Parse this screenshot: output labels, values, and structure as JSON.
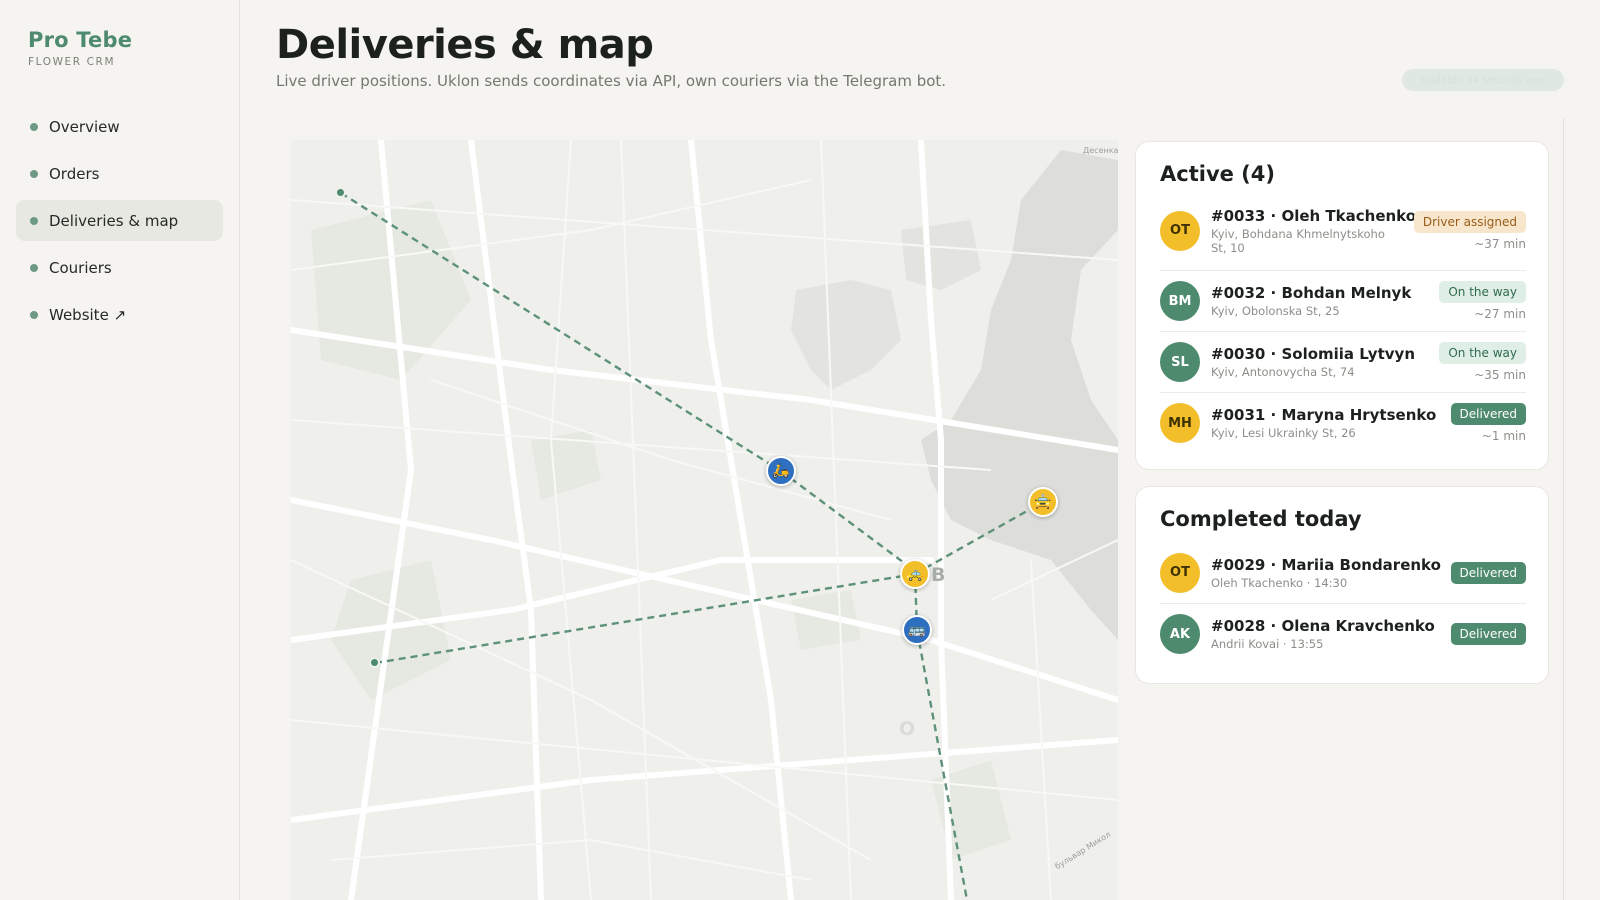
{
  "brand": {
    "name": "Pro Tebe",
    "subtitle": "FLOWER CRM"
  },
  "nav": [
    {
      "label": "Overview",
      "active": false
    },
    {
      "label": "Orders",
      "active": false
    },
    {
      "label": "Deliveries & map",
      "active": true
    },
    {
      "label": "Couriers",
      "active": false
    },
    {
      "label": "Website ↗",
      "active": false
    }
  ],
  "header": {
    "title": "Deliveries & map",
    "subtitle": "Live driver positions. Uklon sends coordinates via API, own couriers via the Telegram bot.",
    "pill_label": "Updated 14 seconds ago"
  },
  "map": {
    "labels": [
      "Десенка",
      "бульвар Микол"
    ],
    "letters": [
      "B",
      "O"
    ],
    "pins": [
      {
        "name": "courier-pin-scooter",
        "icon": "scooter-icon",
        "glyph": "🛵",
        "color": "blue"
      },
      {
        "name": "driver-pin-taxi",
        "icon": "taxi-icon",
        "glyph": "🚕",
        "color": "yellow"
      },
      {
        "name": "driver-pin-car",
        "icon": "car-icon",
        "glyph": "🚖",
        "color": "yellow"
      },
      {
        "name": "courier-pin-bus",
        "icon": "bus-icon",
        "glyph": "🚌",
        "color": "blue"
      }
    ]
  },
  "active": {
    "title": "Active (4)",
    "rows": [
      {
        "initials": "OT",
        "avatar": "yellow",
        "title": "#0033 · Oleh Tkachenko",
        "sub": "Kyiv, Bohdana Khmelnytskoho St, 10",
        "badge": "Driver assigned",
        "badge_kind": "assigned",
        "eta": "~37 min"
      },
      {
        "initials": "BM",
        "avatar": "green",
        "title": "#0032 · Bohdan Melnyk",
        "sub": "Kyiv, Obolonska St, 25",
        "badge": "On the way",
        "badge_kind": "way",
        "eta": "~27 min"
      },
      {
        "initials": "SL",
        "avatar": "green",
        "title": "#0030 · Solomiia Lytvyn",
        "sub": "Kyiv, Antonovycha St, 74",
        "badge": "On the way",
        "badge_kind": "way",
        "eta": "~35 min"
      },
      {
        "initials": "MH",
        "avatar": "yellow",
        "title": "#0031 · Maryna Hrytsenko",
        "sub": "Kyiv, Lesi Ukrainky St, 26",
        "badge": "Delivered",
        "badge_kind": "done",
        "eta": "~1 min"
      }
    ]
  },
  "completed": {
    "title": "Completed today",
    "rows": [
      {
        "initials": "OT",
        "avatar": "yellow",
        "title": "#0029 · Mariia Bondarenko",
        "sub": "Oleh Tkachenko · 14:30",
        "badge": "Delivered",
        "badge_kind": "done"
      },
      {
        "initials": "AK",
        "avatar": "green",
        "title": "#0028 · Olena Kravchenko",
        "sub": "Andrii Kovai · 13:55",
        "badge": "Delivered",
        "badge_kind": "done"
      }
    ]
  },
  "colors": {
    "accent": "#4e8a6e",
    "pin_blue": "#2f6fc0",
    "pin_yellow": "#f2bf2a",
    "badge_assigned": "#f8e6cc"
  }
}
